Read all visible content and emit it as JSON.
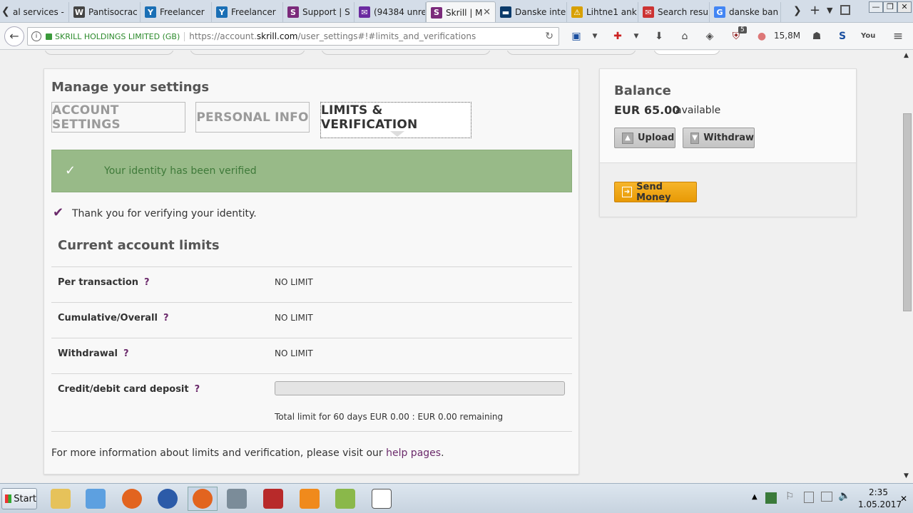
{
  "tabs": [
    {
      "label": "al services -",
      "icon": "globe-icon",
      "color": "#6a8"
    },
    {
      "label": "Pantisocrac",
      "icon": "wikipedia-icon",
      "color": "#444",
      "glyph": "W"
    },
    {
      "label": "Freelancer",
      "icon": "freelancer-icon",
      "color": "#1a6fb5",
      "glyph": "Y"
    },
    {
      "label": "Freelancer",
      "icon": "freelancer-icon",
      "color": "#1a6fb5",
      "glyph": "Y"
    },
    {
      "label": "Support | S",
      "icon": "skrill-icon",
      "color": "#7b2a7b",
      "glyph": "S"
    },
    {
      "label": "(94384 unre",
      "icon": "mail-icon",
      "color": "#6b2aa0",
      "glyph": "✉"
    },
    {
      "label": "Skrill | M",
      "icon": "skrill-icon",
      "color": "#7b2a7b",
      "glyph": "S"
    },
    {
      "label": "Danske inte",
      "icon": "danske-icon",
      "color": "#0a3a6a",
      "glyph": "▬"
    },
    {
      "label": "Lihtne1 ank",
      "icon": "warning-icon",
      "color": "#d8a000",
      "glyph": "⚠"
    },
    {
      "label": "Search resu",
      "icon": "search-icon",
      "color": "#c33",
      "glyph": "✉"
    },
    {
      "label": "danske ban",
      "icon": "google-icon",
      "color": "#4285f4",
      "glyph": "G"
    }
  ],
  "address": {
    "identity": "SKRILL HOLDINGS LIMITED (GB)",
    "url_prefix": "https://account.",
    "url_domain": "skrill.com",
    "url_suffix": "/user_settings#!#limits_and_verifications"
  },
  "toolbar": {
    "badge": "5",
    "memory": "15,8M"
  },
  "settings": {
    "heading": "Manage your settings",
    "tab_account": "ACCOUNT SETTINGS",
    "tab_personal": "PERSONAL INFO",
    "tab_limits": "LIMITS & VERIFICATION",
    "banner": "Your identity has been verified",
    "thanks": "Thank you for verifying your identity.",
    "limits_heading": "Current account limits",
    "rows": [
      {
        "label": "Per transaction",
        "value": "NO LIMIT"
      },
      {
        "label": "Cumulative/Overall",
        "value": "NO LIMIT"
      },
      {
        "label": "Withdrawal",
        "value": "NO LIMIT"
      },
      {
        "label": "Credit/debit card deposit",
        "value": ""
      }
    ],
    "help_mark": "?",
    "deposit_progress": 0,
    "deposit_note": "Total limit for 60 days EUR 0.00 : EUR 0.00 remaining",
    "footer_text": "For more information about limits and verification, please visit our ",
    "footer_link": "help pages",
    "footer_end": "."
  },
  "balance": {
    "title": "Balance",
    "amount": "EUR 65.00",
    "available": "available",
    "upload": "Upload",
    "withdraw": "Withdraw",
    "send": "Send Money"
  },
  "taskbar": {
    "start": "Start",
    "time": "2:35",
    "date": "1.05.2017"
  },
  "colors": {
    "banner": "#98ba88",
    "banner_text": "#3f7a3a",
    "accent": "#6b2a6b",
    "send": "#f0a20c"
  }
}
